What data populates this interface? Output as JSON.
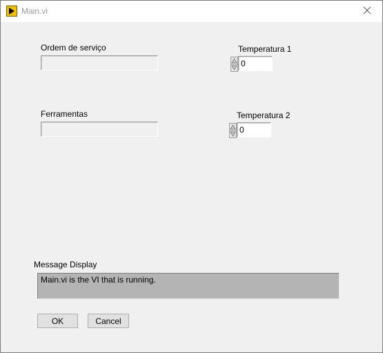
{
  "window": {
    "title": "Main.vi",
    "app_icon": "labview-vi-icon",
    "close_icon": "close-icon"
  },
  "fields": {
    "ordem_label": "Ordem de serviço",
    "ordem_value": "",
    "ferramentas_label": "Ferramentas",
    "ferramentas_value": ""
  },
  "numerics": {
    "temp1_label": "Temperatura 1",
    "temp1_value": "0",
    "temp2_label": "Temperatura 2",
    "temp2_value": "0",
    "incdec_icon": "increment-decrement-arrows"
  },
  "message": {
    "label": "Message Display",
    "text": "Main.vi  is the VI that is running."
  },
  "buttons": {
    "ok_label": "OK",
    "cancel_label": "Cancel"
  },
  "colors": {
    "panel_bg": "#f0f0f0",
    "message_bg": "#b4b4b4",
    "icon_accent": "#f2c200"
  }
}
